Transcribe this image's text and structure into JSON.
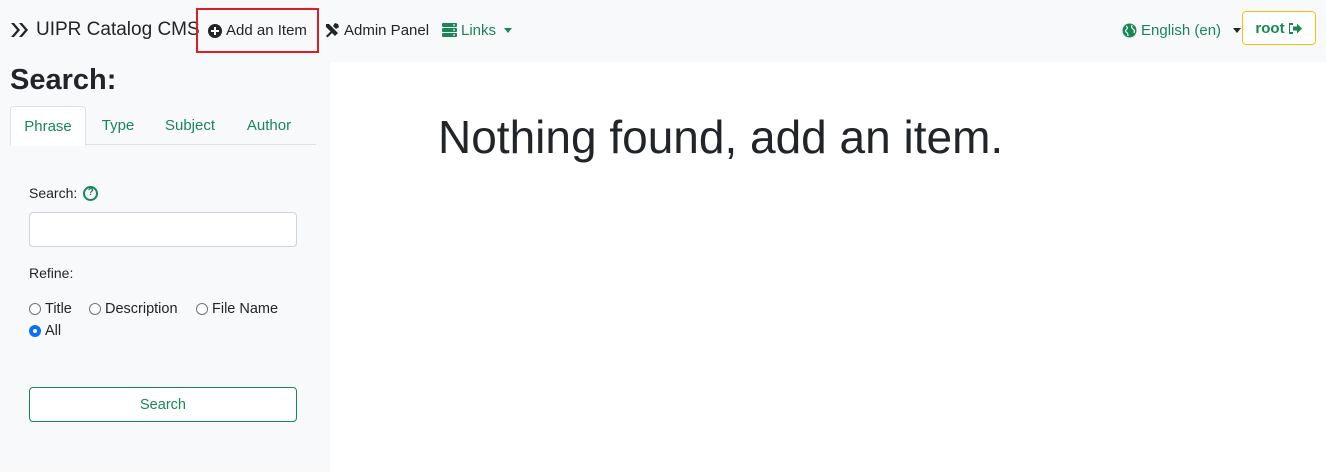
{
  "navbar": {
    "brand": "UIPR Catalog CMS",
    "add_item": "Add an Item",
    "admin_panel": "Admin Panel",
    "links": "Links",
    "language": "English (en)",
    "user": "root"
  },
  "sidebar": {
    "title": "Search:",
    "tabs": [
      "Phrase",
      "Type",
      "Subject",
      "Author"
    ],
    "search_label": "Search:",
    "search_value": "",
    "refine_label": "Refine:",
    "refine_options": [
      {
        "label": "Title",
        "checked": false
      },
      {
        "label": "Description",
        "checked": false
      },
      {
        "label": "File Name",
        "checked": false
      },
      {
        "label": "All",
        "checked": true
      }
    ],
    "search_button": "Search"
  },
  "main": {
    "message": "Nothing found, add an item."
  },
  "colors": {
    "accent": "#198754",
    "highlight_border": "#dc1f26",
    "user_border": "#ffc107",
    "radio_checked": "#0d6efd"
  }
}
